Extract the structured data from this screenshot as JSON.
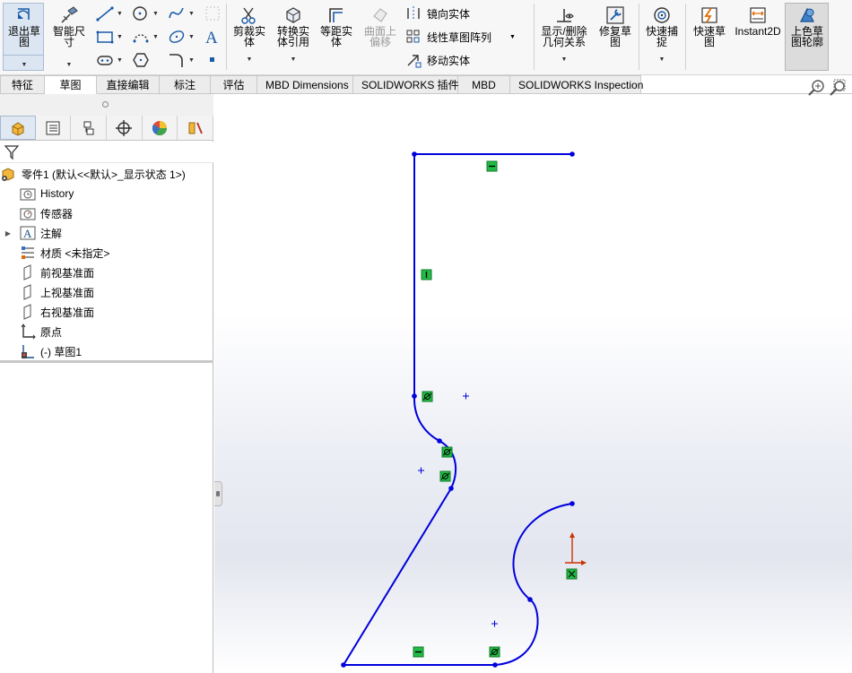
{
  "ribbon": {
    "exit_sketch": "退出草图",
    "smart_dimension": "智能尺寸",
    "trim_entities": "剪裁实体",
    "convert_entities": "转换实体引用",
    "offset_entities": "等距实体",
    "offset_surface": "曲面上偏移",
    "mirror_entities": "镜向实体",
    "linear_pattern": "线性草图阵列",
    "move_entities": "移动实体",
    "display_delete_relations": "显示/删除几何关系",
    "repair_sketch": "修复草图",
    "quick_snaps": "快速捕捉",
    "rapid_sketch": "快速草图",
    "instant2d": "Instant2D",
    "shaded_contours": "上色草图轮廓"
  },
  "tabs": [
    "特征",
    "草图",
    "直接编辑",
    "标注",
    "评估",
    "MBD Dimensions",
    "SOLIDWORKS 插件",
    "MBD",
    "SOLIDWORKS Inspection"
  ],
  "active_tab": "草图",
  "tree": {
    "root": "零件1  (默认<<默认>_显示状态 1>)",
    "history": "History",
    "sensors": "传感器",
    "annotations": "注解",
    "material": "材质 <未指定>",
    "front_plane": "前视基准面",
    "top_plane": "上视基准面",
    "right_plane": "右视基准面",
    "origin": "原点",
    "sketch": "(-) 草图1"
  },
  "colors": {
    "sketch_line": "#0000dd",
    "relation_glyph": "#22bb44",
    "origin_red": "#cc3300",
    "active_tab_bg": "#ffffff",
    "panel_highlight": "#dfe8f3"
  }
}
